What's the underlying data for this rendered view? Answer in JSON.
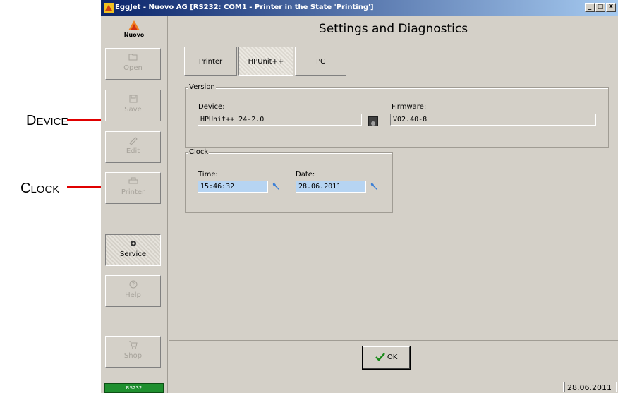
{
  "callouts": {
    "device": {
      "first": "D",
      "rest": "EVICE"
    },
    "clock": {
      "first": "C",
      "rest": "LOCK"
    }
  },
  "window": {
    "title": "EggJet - Nuovo AG   [RS232: COM1 - Printer in the State 'Printing']",
    "controls": [
      "_",
      "□",
      "X"
    ]
  },
  "logo": {
    "text": "Nuovo"
  },
  "sidebar": {
    "items": [
      {
        "label": "Open",
        "icon": "folder-open-icon",
        "enabled": false
      },
      {
        "label": "Save",
        "icon": "floppy-icon",
        "enabled": false
      },
      {
        "label": "Edit",
        "icon": "edit-icon",
        "enabled": false
      },
      {
        "label": "Printer",
        "icon": "printer-icon",
        "enabled": false
      },
      {
        "label": "Service",
        "icon": "gear-icon",
        "enabled": true,
        "active": true
      },
      {
        "label": "Help",
        "icon": "help-icon",
        "enabled": false
      },
      {
        "label": "Shop",
        "icon": "cart-icon",
        "enabled": false
      }
    ]
  },
  "header": {
    "title": "Settings and Diagnostics"
  },
  "tabs": [
    {
      "label": "Printer"
    },
    {
      "label": "HPUnit++",
      "active": true
    },
    {
      "label": "PC"
    }
  ],
  "version": {
    "title": "Version",
    "device_label": "Device:",
    "device_value": "HPUnit++ 24-2.0",
    "firmware_label": "Firmware:",
    "firmware_value": "V02.40-8"
  },
  "clock": {
    "title": "Clock",
    "time_label": "Time:",
    "time_value": "15:46:32",
    "date_label": "Date:",
    "date_value": "28.06.2011"
  },
  "ok_button": {
    "label": "OK"
  },
  "statusbar": {
    "connection": "RS232",
    "date": "28.06.2011"
  },
  "colors": {
    "accent_red": "#e00000",
    "window_bg": "#d4d0c8",
    "edit_field": "#b6d4f2",
    "status_green": "#1f8f2f"
  }
}
